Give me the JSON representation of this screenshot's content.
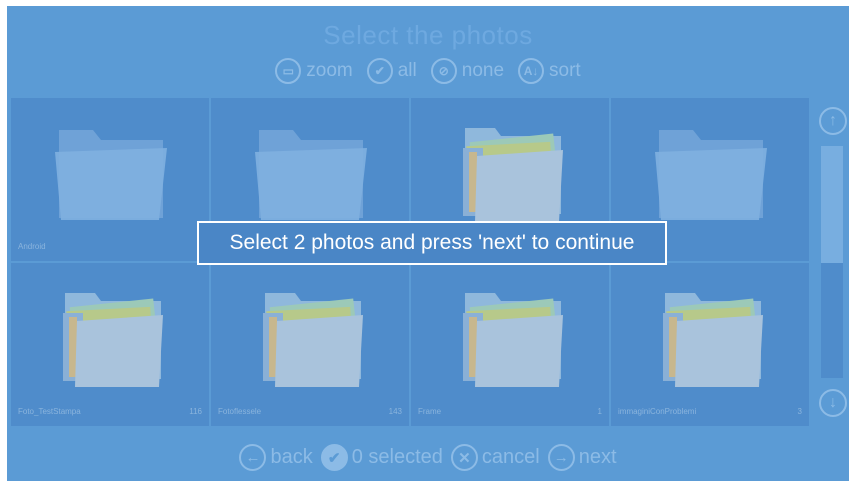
{
  "title": "Select the photos",
  "toolbar": [
    {
      "label": "zoom",
      "icon": "zoom-icon",
      "glyph": "▭"
    },
    {
      "label": "all",
      "icon": "select-all-icon",
      "glyph": "✔"
    },
    {
      "label": "none",
      "icon": "select-none-icon",
      "glyph": "⊘"
    },
    {
      "label": "sort",
      "icon": "sort-az-icon",
      "glyph": "A↓"
    }
  ],
  "tiles": [
    {
      "name": "Android",
      "count": "",
      "type": "empty"
    },
    {
      "name": "",
      "count": "",
      "type": "empty"
    },
    {
      "name": "",
      "count": "",
      "type": "photos"
    },
    {
      "name": "",
      "count": "",
      "type": "empty"
    },
    {
      "name": "Foto_TestStampa",
      "count": "116",
      "type": "photos"
    },
    {
      "name": "Fotoflessele",
      "count": "143",
      "type": "photos"
    },
    {
      "name": "Frame",
      "count": "1",
      "type": "photos"
    },
    {
      "name": "immaginiConProblemi",
      "count": "3",
      "type": "photos"
    }
  ],
  "scroll": {
    "up_glyph": "↑",
    "down_glyph": "↓",
    "position": 0.0
  },
  "message": "Select 2 photos and press 'next' to continue",
  "bottom": {
    "back": {
      "label": "back",
      "glyph": "←"
    },
    "selected": {
      "label": "0 selected",
      "glyph": "✔"
    },
    "cancel": {
      "label": "cancel",
      "glyph": "✕"
    },
    "next": {
      "label": "next",
      "glyph": "→"
    }
  },
  "colors": {
    "background": "#5b9bd5",
    "tile": "#4f8ccb",
    "text_dim": "#8cbbe6",
    "message_border": "#ffffff"
  }
}
